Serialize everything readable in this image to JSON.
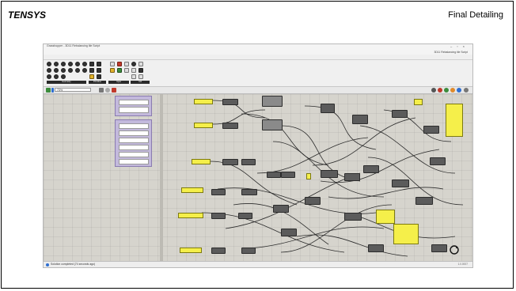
{
  "slide": {
    "title": "TENSYS",
    "subtitle": "Final Detailing"
  },
  "app": {
    "window_title": "Grasshopper - 3D11 Rebalancing tile Script",
    "document_title": "3D11 Rebalancing tile Script",
    "menus": [
      "File",
      "Edit",
      "View",
      "Display",
      "Solution",
      "Help",
      "Meta"
    ],
    "tabs": [
      "Params",
      "Maths",
      "Sets",
      "Vector",
      "Curve",
      "Surface",
      "Mesh",
      "Intersect",
      "Transform",
      "Display",
      "Kangaroo2",
      "Weaverbird",
      "Lunchbox",
      "Pufferfish",
      "Human"
    ],
    "active_tab": "Params",
    "ribbon_groups": [
      "Geometry",
      "Primitive",
      "Input",
      "Util"
    ],
    "zoom": "73%",
    "status": "Solution completed (74 seconds ago)",
    "version": "1.0.0007"
  },
  "colors": {
    "canvas": "#d6d4cd",
    "group": "#c3b9dc",
    "param_yellow": "#f5ef4a",
    "component": "#5b5b5b"
  }
}
